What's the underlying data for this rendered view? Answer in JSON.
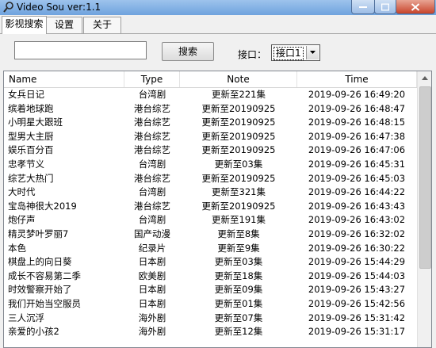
{
  "window": {
    "title": "Video Sou  ver:1.1"
  },
  "tabs": [
    {
      "label": "影视搜索",
      "active": true
    },
    {
      "label": "设置",
      "active": false
    },
    {
      "label": "关于",
      "active": false
    }
  ],
  "search": {
    "value": "",
    "button_label": "搜索"
  },
  "api": {
    "label": "接口：",
    "selected": "接口1"
  },
  "list": {
    "columns": [
      "Name",
      "Type",
      "Note",
      "Time"
    ],
    "rows": [
      [
        "女兵日记",
        "台湾剧",
        "更新至221集",
        "2019-09-26 16:49:20"
      ],
      [
        "缤着地球跑",
        "港台综艺",
        "更新至20190925",
        "2019-09-26 16:48:47"
      ],
      [
        "小明星大跟班",
        "港台综艺",
        "更新至20190925",
        "2019-09-26 16:48:15"
      ],
      [
        "型男大主厨",
        "港台综艺",
        "更新至20190925",
        "2019-09-26 16:47:38"
      ],
      [
        "娱乐百分百",
        "港台综艺",
        "更新至20190925",
        "2019-09-26 16:47:06"
      ],
      [
        "忠孝节义",
        "台湾剧",
        "更新至03集",
        "2019-09-26 16:45:31"
      ],
      [
        "综艺大热门",
        "港台综艺",
        "更新至20190925",
        "2019-09-26 16:45:03"
      ],
      [
        "大时代",
        "台湾剧",
        "更新至321集",
        "2019-09-26 16:44:22"
      ],
      [
        "宝岛神很大2019",
        "港台综艺",
        "更新至20190925",
        "2019-09-26 16:43:43"
      ],
      [
        "炮仔声",
        "台湾剧",
        "更新至191集",
        "2019-09-26 16:43:02"
      ],
      [
        "精灵梦叶罗丽7",
        "国产动漫",
        "更新至8集",
        "2019-09-26 16:32:02"
      ],
      [
        "本色",
        "纪录片",
        "更新至9集",
        "2019-09-26 16:30:22"
      ],
      [
        "棋盘上的向日葵",
        "日本剧",
        "更新至03集",
        "2019-09-26 15:44:29"
      ],
      [
        "成长不容易第二季",
        "欧美剧",
        "更新至18集",
        "2019-09-26 15:44:03"
      ],
      [
        "时效警察开始了",
        "日本剧",
        "更新至09集",
        "2019-09-26 15:43:27"
      ],
      [
        "我们开始当空服员",
        "日本剧",
        "更新至01集",
        "2019-09-26 15:42:56"
      ],
      [
        "三人沉浮",
        "海外剧",
        "更新至07集",
        "2019-09-26 15:31:42"
      ],
      [
        "亲爱的小孩2",
        "海外剧",
        "更新至12集",
        "2019-09-26 15:31:17"
      ]
    ]
  }
}
